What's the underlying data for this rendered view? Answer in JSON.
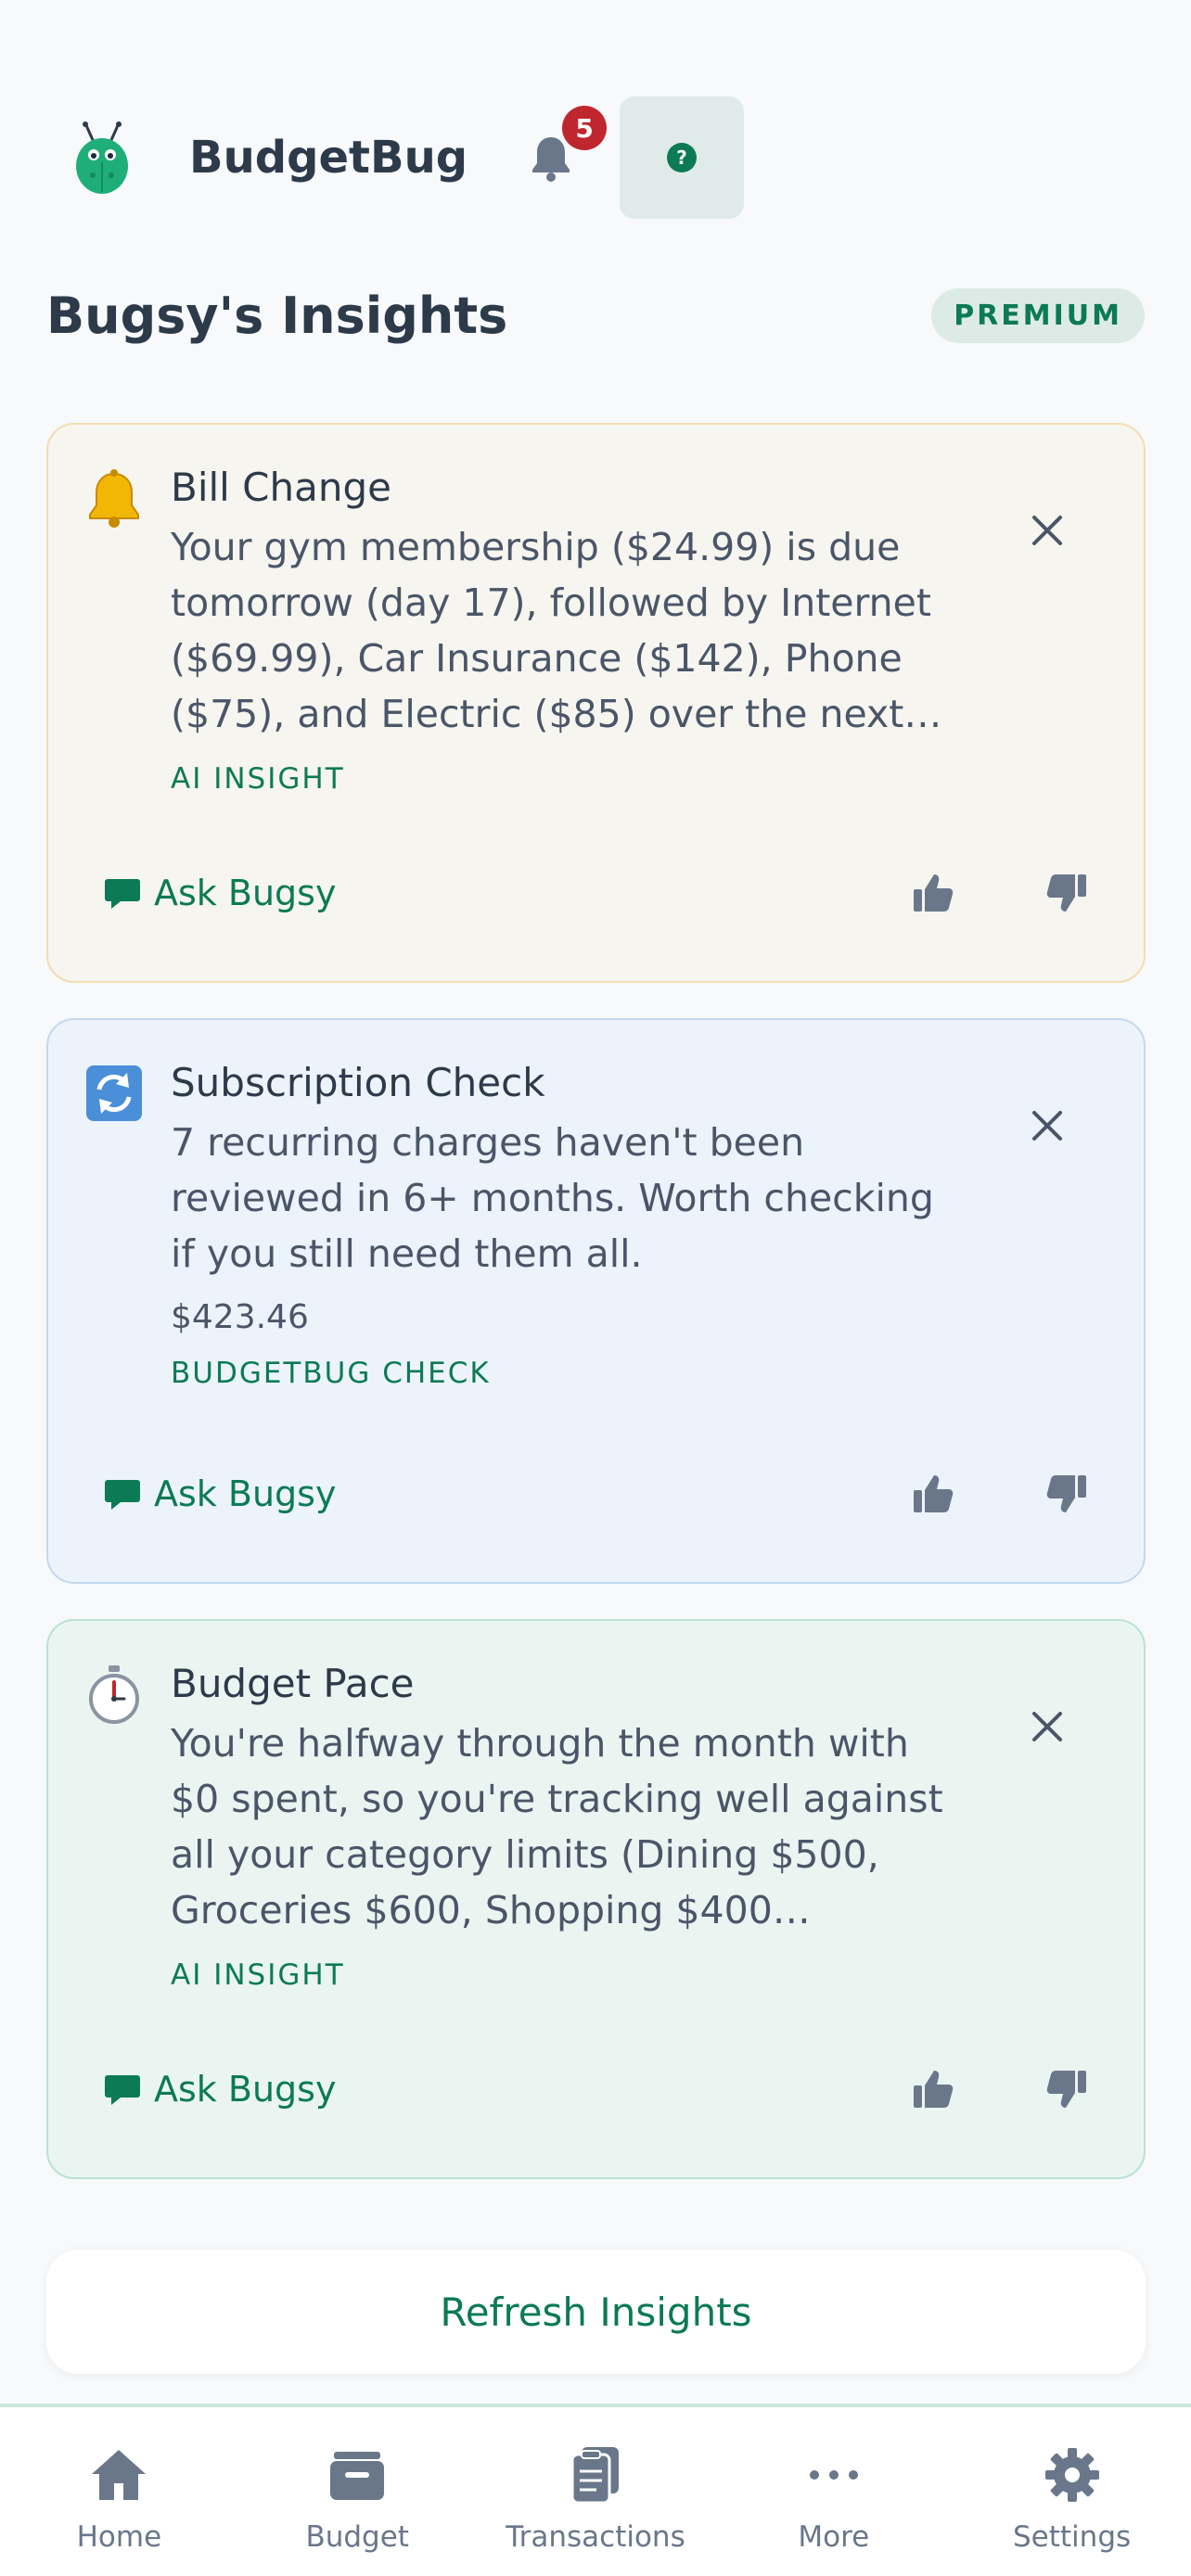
{
  "header": {
    "app_title": "BudgetBug",
    "notification_count": "5",
    "help_label": "?"
  },
  "section": {
    "title": "Bugsy's Insights",
    "badge": "PREMIUM"
  },
  "insights": [
    {
      "icon": "bell-icon",
      "title": "Bill Change",
      "text": "Your gym membership ($24.99) is due tomorrow (day 17), followed by Internet ($69.99), Car Insurance ($142), Phone ($75), and Electric ($85) over the next…",
      "amount": "",
      "tag": "AI INSIGHT",
      "ask_label": "Ask Bugsy",
      "accent": "#f3deb0"
    },
    {
      "icon": "refresh-arrows-icon",
      "title": "Subscription Check",
      "text": "7 recurring charges haven't been reviewed in 6+ months. Worth checking if you still need them all.",
      "amount": "$423.46",
      "tag": "BUDGETBUG CHECK",
      "ask_label": "Ask Bugsy",
      "accent": "#c3d8ef"
    },
    {
      "icon": "stopwatch-icon",
      "title": "Budget Pace",
      "text": "You're halfway through the month with $0 spent, so you're tracking well against all your category limits (Dining $500, Groceries $600, Shopping $400…",
      "amount": "",
      "tag": "AI INSIGHT",
      "ask_label": "Ask Bugsy",
      "accent": "#b7e3d3"
    }
  ],
  "refresh_label": "Refresh Insights",
  "tabs": [
    {
      "label": "Home",
      "icon": "home-icon"
    },
    {
      "label": "Budget",
      "icon": "wallet-icon"
    },
    {
      "label": "Transactions",
      "icon": "clipboard-icon"
    },
    {
      "label": "More",
      "icon": "more-dots-icon"
    },
    {
      "label": "Settings",
      "icon": "gear-icon"
    }
  ],
  "colors": {
    "brand": "#0c7a55",
    "badge_red": "#c0262d",
    "text": "#2d3a4a"
  }
}
